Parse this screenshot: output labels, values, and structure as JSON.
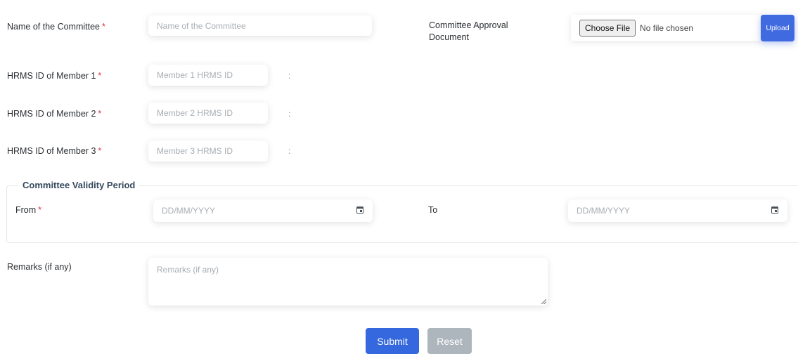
{
  "form": {
    "committee_name": {
      "label": "Name of the Committee",
      "required_mark": "*",
      "placeholder": "Name of the Committee",
      "value": ""
    },
    "approval_document": {
      "label_line1": "Committee Approval",
      "label_line2": "Document",
      "choose_file_label": "Choose File",
      "file_status": "No file chosen",
      "upload_label": "Upload"
    },
    "members": [
      {
        "label": "HRMS ID of Member 1",
        "required_mark": "*",
        "placeholder": "Member 1 HRMS ID",
        "separator": ":",
        "value": ""
      },
      {
        "label": "HRMS ID of Member 2",
        "required_mark": "*",
        "placeholder": "Member 2 HRMS ID",
        "separator": ":",
        "value": ""
      },
      {
        "label": "HRMS ID of Member 3",
        "required_mark": "*",
        "placeholder": "Member 3 HRMS ID",
        "separator": ":",
        "value": ""
      }
    ],
    "validity": {
      "legend": "Committee Validity Period",
      "from_label": "From",
      "from_required_mark": "*",
      "from_placeholder": "DD/MM/YYYY",
      "to_label": "To",
      "to_placeholder": "DD/MM/YYYY",
      "icon": "calendar-icon"
    },
    "remarks": {
      "label": "Remarks (if any)",
      "placeholder": "Remarks (if any)",
      "value": ""
    },
    "actions": {
      "submit_label": "Submit",
      "reset_label": "Reset"
    }
  },
  "colors": {
    "required": "#dc3545",
    "primary": "#3568de",
    "secondary": "#adb5bd"
  }
}
